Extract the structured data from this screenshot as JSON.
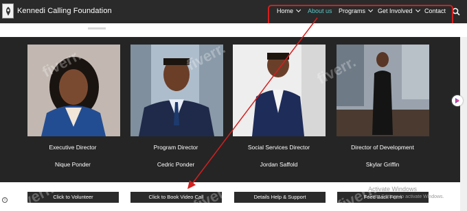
{
  "header": {
    "site_title": "Kennedi Calling Foundation",
    "logo_icon": "foundation-logo-icon",
    "nav": [
      {
        "label": "Home",
        "has_dropdown": true,
        "active": false
      },
      {
        "label": "About us",
        "has_dropdown": false,
        "active": true
      },
      {
        "label": "Programs",
        "has_dropdown": true,
        "active": false
      },
      {
        "label": "Get Involved",
        "has_dropdown": true,
        "active": false
      },
      {
        "label": "Contact",
        "has_dropdown": false,
        "active": false
      }
    ],
    "search_icon": "search-icon"
  },
  "team": [
    {
      "role": "Executive Director",
      "name": "Nique Ponder"
    },
    {
      "role": "Program Director",
      "name": "Cedric Ponder"
    },
    {
      "role": "Social Services Director",
      "name": "Jordan Saffold"
    },
    {
      "role": "Director of Development",
      "name": "Skylar Griffin"
    }
  ],
  "actions": [
    {
      "label": "Click to Volunteer"
    },
    {
      "label": "Click to Book Video Call"
    },
    {
      "label": "Details Help & Support"
    },
    {
      "label": "Feed Back Form"
    }
  ],
  "overlay": {
    "watermark": "fiverr.",
    "activate_title": "Activate Windows",
    "activate_sub": "Go to Settings to activate Windows."
  },
  "colors": {
    "nav_bg": "#2a2a2a",
    "panel_bg": "#252525",
    "active_link": "#5bc8c8",
    "annotation_red": "#d61f1f",
    "button_bg": "#2b2b2b"
  }
}
